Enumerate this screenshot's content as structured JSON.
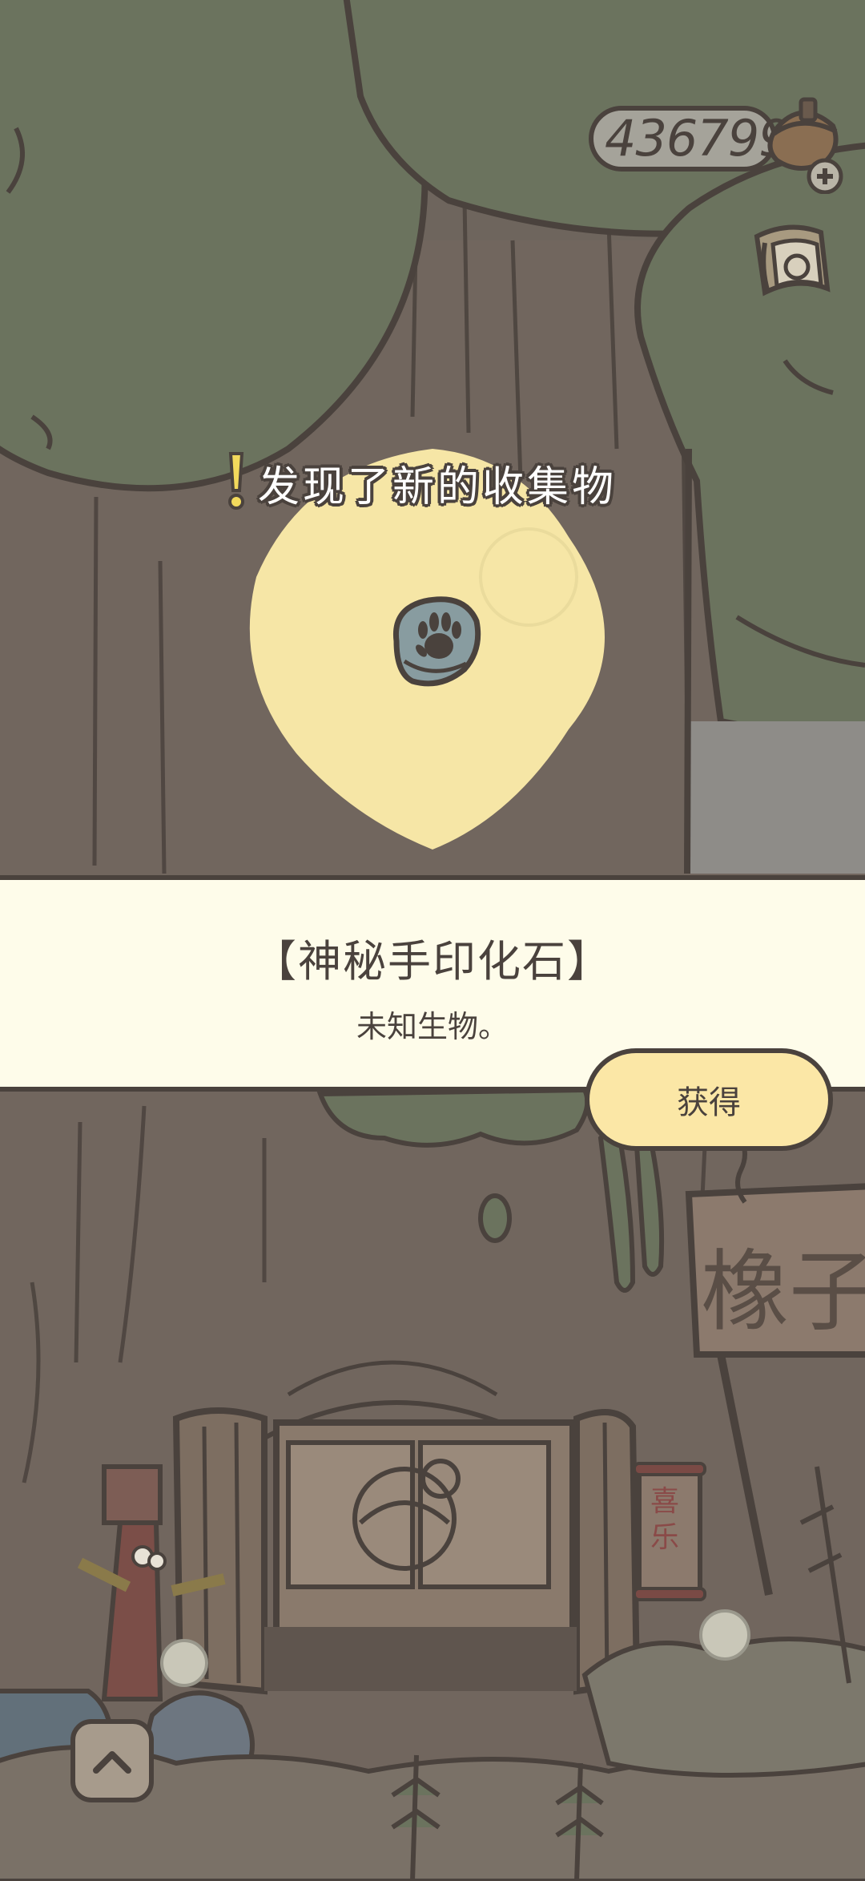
{
  "hud": {
    "acorn_count": "436799",
    "acorn_icon": "acorn-icon",
    "add_icon": "plus-icon",
    "album_icon": "album-icon"
  },
  "discovery": {
    "title": "发现了新的收集物",
    "item_icon": "handprint-fossil-icon"
  },
  "item": {
    "name": "【神秘手印化石】",
    "description": "未知生物。"
  },
  "actions": {
    "obtain_label": "获得",
    "menu_icon": "chevron-up-icon"
  },
  "scene": {
    "sign_text": "橡子",
    "scroll_text": "喜乐"
  },
  "colors": {
    "outline": "#4a423d",
    "banner": "#fefcea",
    "button": "#fbe7a6",
    "glow": "#f6e6a6"
  }
}
